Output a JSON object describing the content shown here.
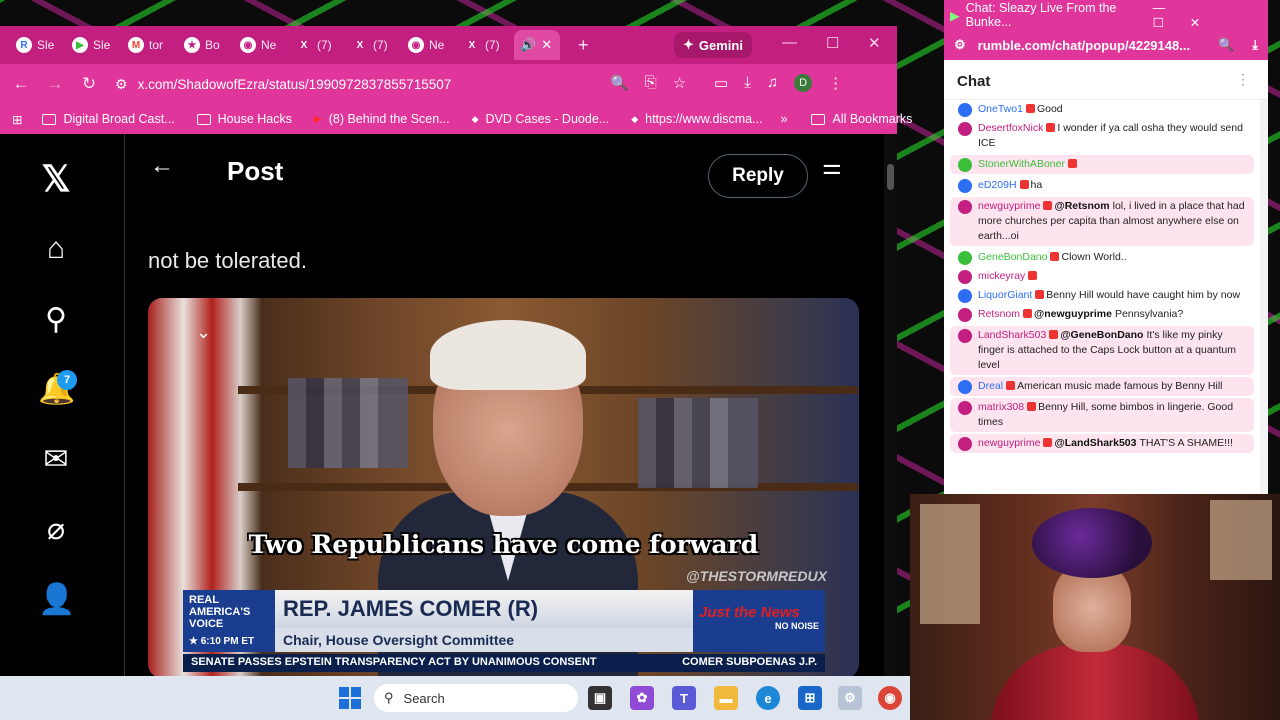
{
  "browser": {
    "tabs": [
      {
        "label": "Sle",
        "icon": "R",
        "icon_color": "#2d6ef5"
      },
      {
        "label": "Sle",
        "icon": "▶",
        "icon_color": "#3bbf3b"
      },
      {
        "label": "tor",
        "icon": "M",
        "icon_color": "#ea4335"
      },
      {
        "label": "Bo",
        "icon": "★",
        "icon_color": "#c21f80"
      },
      {
        "label": "Ne",
        "icon": "◉",
        "icon_color": "#c21f80"
      },
      {
        "label": "(7)",
        "icon": "X",
        "icon_color": "#000000"
      },
      {
        "label": "(7)",
        "icon": "X",
        "icon_color": "#000000"
      },
      {
        "label": "Ne",
        "icon": "◉",
        "icon_color": "#c21f80"
      },
      {
        "label": "(7)",
        "icon": "X",
        "icon_color": "#000000"
      }
    ],
    "active_tab_icon": "speaker-icon",
    "gemini_label": "Gemini",
    "url": "x.com/ShadowofEzra/status/1990972837855715507",
    "profile_initial": "D",
    "bookmarks": [
      {
        "label": "Digital Broad Cast...",
        "icon": "folder-icon"
      },
      {
        "label": "House Hacks",
        "icon": "folder-icon"
      },
      {
        "label": "(8) Behind the Scen...",
        "icon": "youtube-icon"
      },
      {
        "label": "DVD Cases - Duode...",
        "icon": "site-icon"
      },
      {
        "label": "https://www.discma...",
        "icon": "site-icon"
      }
    ],
    "all_bookmarks": "All Bookmarks"
  },
  "x": {
    "header_title": "Post",
    "reply_label": "Reply",
    "notification_count": "7",
    "tweet_text": "not be tolerated.",
    "video": {
      "caption": "Two Republicans have come forward",
      "watermark": "@THESTORMREDUX",
      "network": "REAL AMERICA'S VOICE",
      "time": "6:10 PM ET",
      "name": "REP. JAMES COMER (R)",
      "role": "Chair, House Oversight Committee",
      "logo": "Just the News",
      "logo_sub": "NO NOISE",
      "ticker_left": "SENATE PASSES EPSTEIN TRANSPARENCY ACT BY UNANIMOUS CONSENT",
      "ticker_right": "COMER SUBPOENAS J.P."
    }
  },
  "taskbar": {
    "search_placeholder": "Search"
  },
  "chat": {
    "window_title": "Chat: Sleazy Live From the Bunke...",
    "url": "rumble.com/chat/popup/4229148...",
    "header": "Chat",
    "messages": [
      {
        "user": "OneTwo1",
        "color": "#2d6ef5",
        "text": "Good",
        "highlight": false
      },
      {
        "user": "DesertfoxNick",
        "color": "#c21f80",
        "text": "I wonder if ya call osha they would send ICE",
        "highlight": false
      },
      {
        "user": "StonerWithABoner",
        "color": "#3bbf3b",
        "text": "",
        "highlight": true
      },
      {
        "user": "eD209H",
        "color": "#2d6ef5",
        "text": "ha",
        "highlight": false
      },
      {
        "user": "newguyprime",
        "color": "#c21f80",
        "mention": "@Retsnom",
        "text": "lol, i lived in a place that had more churches per capita than almost anywhere else on earth...oi",
        "highlight": true
      },
      {
        "user": "GeneBonDano",
        "color": "#3bbf3b",
        "text": "Clown World..",
        "highlight": false
      },
      {
        "user": "mickeyray",
        "color": "#c21f80",
        "text": "",
        "highlight": false
      },
      {
        "user": "LiquorGiant",
        "color": "#2d6ef5",
        "text": "Benny Hill would have caught him by now",
        "highlight": false
      },
      {
        "user": "Retsnom",
        "color": "#c21f80",
        "mention": "@newguyprime",
        "text": "Pennsylvania?",
        "highlight": false
      },
      {
        "user": "LandShark503",
        "color": "#c21f80",
        "mention": "@GeneBonDano",
        "text": "It's like my pinky finger is attached to the Caps Lock button at a quantum level",
        "highlight": true
      },
      {
        "user": "Dreal",
        "color": "#2d6ef5",
        "text": "American music made famous by Benny Hill",
        "highlight": true
      },
      {
        "user": "matrix308",
        "color": "#c21f80",
        "text": "Benny Hill, some bimbos in lingerie. Good times",
        "highlight": true
      },
      {
        "user": "newguyprime",
        "color": "#c21f80",
        "mention": "@LandShark503",
        "text": "THAT'S A SHAME!!!",
        "highlight": true
      }
    ]
  }
}
